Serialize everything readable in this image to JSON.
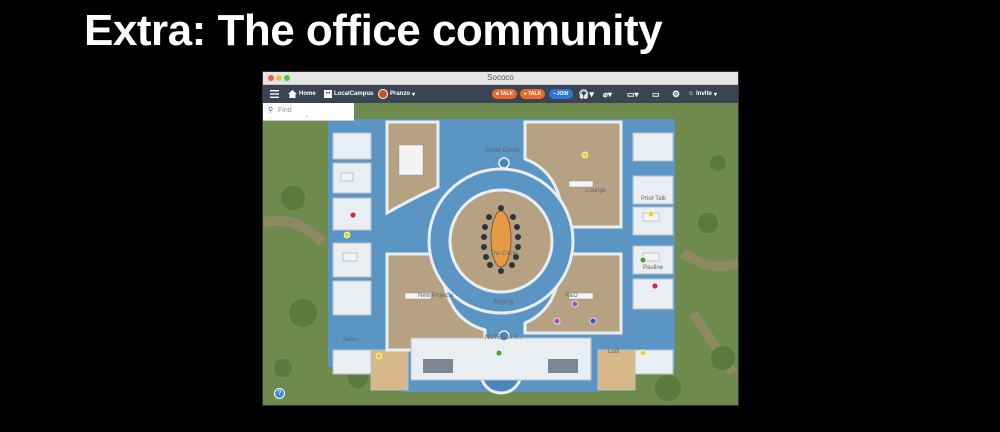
{
  "slide": {
    "title": "Extra: The office community"
  },
  "window": {
    "title": "Sococo"
  },
  "toolbar": {
    "home": "Home",
    "campus": "LocalCampus",
    "user": "Pranzo",
    "talk_cam": "TALK",
    "talk": "TALK",
    "join": "JOIN",
    "invite": "Invite"
  },
  "search": {
    "placeholder": "Find"
  },
  "rooms": {
    "water_cooler": "Water Cooler",
    "lounge": "Lounge",
    "the_circle": "The Circle",
    "new_projects": "New Projects",
    "jogging": "Jogging",
    "rd": "R&D",
    "nutella": "NUTELLA R...",
    "sales": "Sales",
    "prior_talk": "Prior Talk",
    "pauline": "Pauline",
    "lodi": "Lodi"
  },
  "colors": {
    "grass": "#6e8a4c",
    "water": "#5b95c3",
    "floor": "#b6a182",
    "wall": "#e9eef2",
    "toolbar": "#3b4452",
    "talk_orange": "#ea6a2e",
    "join_blue": "#2f76d2"
  },
  "help": {
    "icon": "question-icon",
    "glyph": "?"
  }
}
